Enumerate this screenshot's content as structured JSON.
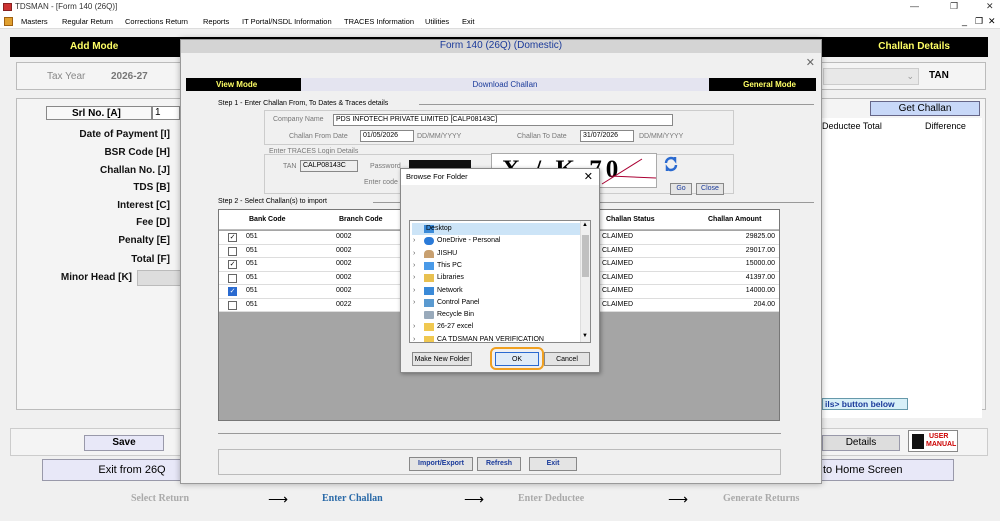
{
  "app": {
    "title": "TDSMAN - [Form 140 (26Q)]",
    "menu": [
      "Masters",
      "Regular Return",
      "Corrections Return",
      "Reports",
      "IT Portal/NSDL Information",
      "TRACES Information",
      "Utilities",
      "Exit"
    ]
  },
  "header": {
    "left": "Add Mode",
    "right": "Challan Details"
  },
  "background": {
    "tax_year_label": "Tax Year",
    "tax_year_value": "2026-27",
    "tan_label": "TAN",
    "srl_label": "Srl No. [A]",
    "srl_value": "1",
    "labels": [
      "Date of Payment [I]",
      "BSR Code [H]",
      "Challan No. [J]",
      "TDS [B]",
      "Interest [C]",
      "Fee [D]",
      "Penalty [E]",
      "Total [F]",
      "Minor Head [K]"
    ],
    "get_challan": "Get Challan",
    "deductee_total": "Deductee Total",
    "difference": "Difference",
    "hint_tail": "ils> button below",
    "save": "Save",
    "details": "Details",
    "user_manual_line1": "USER",
    "user_manual_line2": "MANUAL",
    "exit_from": "Exit from 26Q",
    "to_home": "to Home Screen"
  },
  "workflow": {
    "steps": [
      "Select Return",
      "Enter Challan",
      "Enter Deductee",
      "Generate Returns"
    ],
    "active": "Enter Challan"
  },
  "dialog": {
    "title": "Form 140 (26Q) (Domestic)",
    "mode_left": "View Mode",
    "mode_center": "Download Challan",
    "mode_right": "General Mode",
    "step1": "Step 1 - Enter Challan From, To Dates & Traces details",
    "company_label": "Company Name",
    "company_value": "PDS INFOTECH PRIVATE LIMITED [CALP08143C]",
    "from_label": "Challan From Date",
    "from_value": "01/05/2026",
    "date_fmt": "DD/MM/YYYY",
    "to_label": "Challan To Date",
    "to_value": "31/07/2026",
    "traces_label": "Enter TRACES Login Details",
    "tan_label": "TAN",
    "tan_value": "CALP08143C",
    "password_label": "Password",
    "enter_code_label": "Enter code",
    "captcha": "X / K 70",
    "go": "Go",
    "close": "Close",
    "step2": "Step 2 - Select Challan(s) to import",
    "columns": [
      "Bank Code",
      "Branch Code",
      "Challan Status",
      "Challan Amount"
    ],
    "rows": [
      {
        "checked": true,
        "bank": "051",
        "branch": "0002",
        "status": "CLAIMED",
        "amount": "29825.00"
      },
      {
        "checked": false,
        "bank": "051",
        "branch": "0002",
        "status": "CLAIMED",
        "amount": "29017.00"
      },
      {
        "checked": true,
        "bank": "051",
        "branch": "0002",
        "status": "CLAIMED",
        "amount": "15000.00"
      },
      {
        "checked": false,
        "bank": "051",
        "branch": "0002",
        "status": "CLAIMED",
        "amount": "41397.00"
      },
      {
        "checked": true,
        "bank": "051",
        "branch": "0002",
        "status": "CLAIMED",
        "amount": "14000.00"
      },
      {
        "checked": false,
        "bank": "051",
        "branch": "0022",
        "status": "CLAIMED",
        "amount": "204.00"
      }
    ],
    "import_export": "Import/Export",
    "refresh": "Refresh",
    "exit": "Exit"
  },
  "browse": {
    "title": "Browse For Folder",
    "items": [
      {
        "label": "Desktop",
        "icon": "desktop-icon",
        "selected": true
      },
      {
        "label": "OneDrive - Personal",
        "icon": "cloud-icon"
      },
      {
        "label": "JISHU",
        "icon": "user-icon"
      },
      {
        "label": "This PC",
        "icon": "computer-icon"
      },
      {
        "label": "Libraries",
        "icon": "library-icon"
      },
      {
        "label": "Network",
        "icon": "network-icon"
      },
      {
        "label": "Control Panel",
        "icon": "control-panel-icon"
      },
      {
        "label": "Recycle Bin",
        "icon": "recycle-bin-icon"
      },
      {
        "label": "26-27 excel",
        "icon": "folder-icon"
      },
      {
        "label": "CA TDSMAN PAN VERIFICATION",
        "icon": "folder-icon"
      }
    ],
    "make_new_folder": "Make New Folder",
    "ok": "OK",
    "cancel": "Cancel"
  },
  "colors": {
    "accent_yellow": "#ffff66",
    "title_blue": "#1a3a9a",
    "highlight_orange": "#f0a020"
  }
}
